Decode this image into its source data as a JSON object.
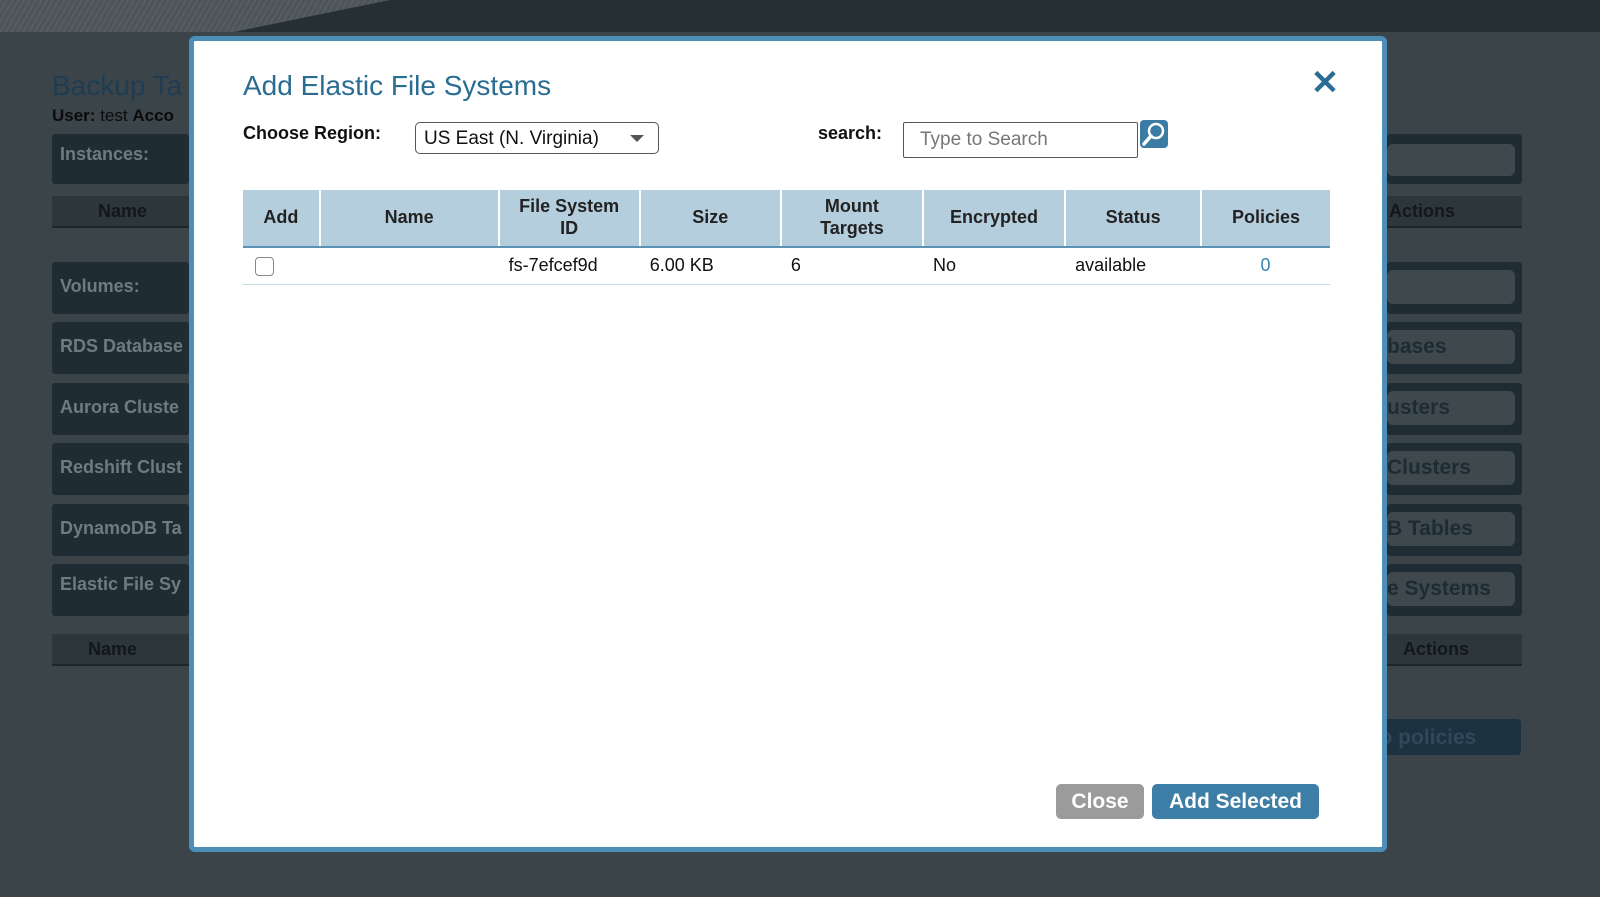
{
  "background": {
    "title": "Backup Ta",
    "user_label": "User:",
    "user_value": "test",
    "account_label": "Acco",
    "instances_label": "Instances:",
    "col_name": "Name",
    "col_actions": "Actions",
    "sections": [
      {
        "label": "Volumes:",
        "pill": ""
      },
      {
        "label": "RDS Database",
        "pill": "bases"
      },
      {
        "label": "Aurora Cluste",
        "pill": "usters"
      },
      {
        "label": "Redshift Clust",
        "pill": "Clusters"
      },
      {
        "label": "DynamoDB Ta",
        "pill": "B Tables"
      },
      {
        "label": "Elastic File Sy",
        "pill": "e Systems"
      }
    ],
    "efs_col_name": "Name",
    "efs_col_actions": "Actions",
    "back_button": "k to policies"
  },
  "modal": {
    "title": "Add Elastic File Systems",
    "close_icon": "close-icon",
    "region_label": "Choose Region:",
    "region_value": "US East (N. Virginia)",
    "search_label": "search:",
    "search_placeholder": "Type to Search",
    "search_icon": "magnifier-icon",
    "columns": [
      "Add",
      "Name",
      "File System ID",
      "Size",
      "Mount Targets",
      "Encrypted",
      "Status",
      "Policies"
    ],
    "rows": [
      {
        "name": "",
        "file_system_id": "fs-7efcef9d",
        "size": "6.00 KB",
        "mount_targets": "6",
        "encrypted": "No",
        "status": "available",
        "policies": "0"
      }
    ],
    "close_button": "Close",
    "add_selected_button": "Add Selected"
  },
  "colors": {
    "accent": "#3d7ea6",
    "modal_border": "#4d8fb8",
    "table_header": "#b5cedd"
  }
}
